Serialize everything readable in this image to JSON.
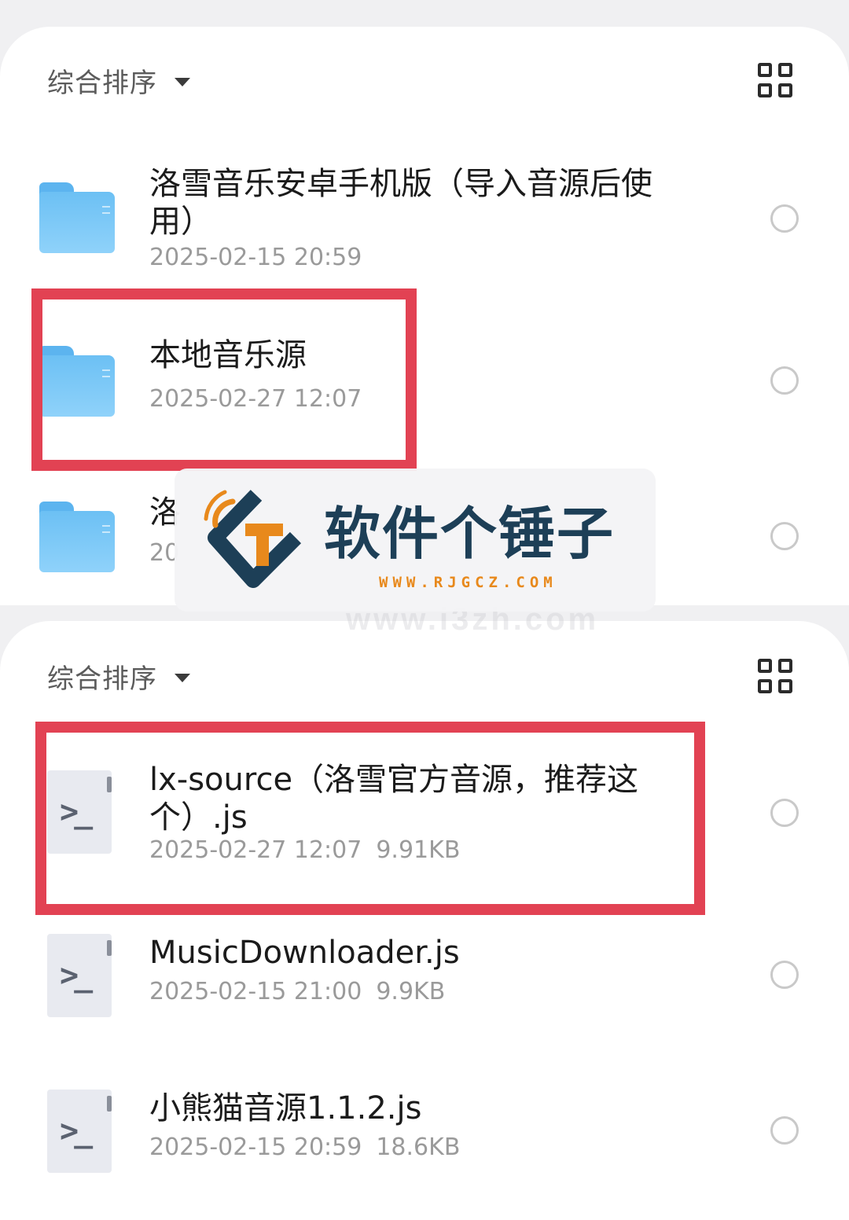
{
  "panel_top": {
    "sort_label": "综合排序",
    "items": [
      {
        "name": "洛雪音乐安卓手机版（导入音源后使用）",
        "date": "2025-02-15 20:59"
      },
      {
        "name": "本地音乐源",
        "date": "2025-02-27 12:07"
      },
      {
        "name": "洛",
        "date": "20"
      }
    ]
  },
  "panel_bottom": {
    "sort_label": "综合排序",
    "items": [
      {
        "name": "lx-source（洛雪官方音源，推荐这个）.js",
        "date": "2025-02-27 12:07",
        "size": "9.91KB"
      },
      {
        "name": "MusicDownloader.js",
        "date": "2025-02-15 21:00",
        "size": "9.9KB"
      },
      {
        "name": "小熊猫音源1.1.2.js",
        "date": "2025-02-15 20:59",
        "size": "18.6KB"
      }
    ]
  },
  "watermark": {
    "title": "软件个锤子",
    "url": "WWW.RJGCZ.COM",
    "faint_url": "www.i3zh.com"
  },
  "colors": {
    "highlight": "#e24253",
    "folder": "#6cc0f4",
    "brand_dark": "#1d3f57",
    "brand_orange": "#e8891c"
  }
}
